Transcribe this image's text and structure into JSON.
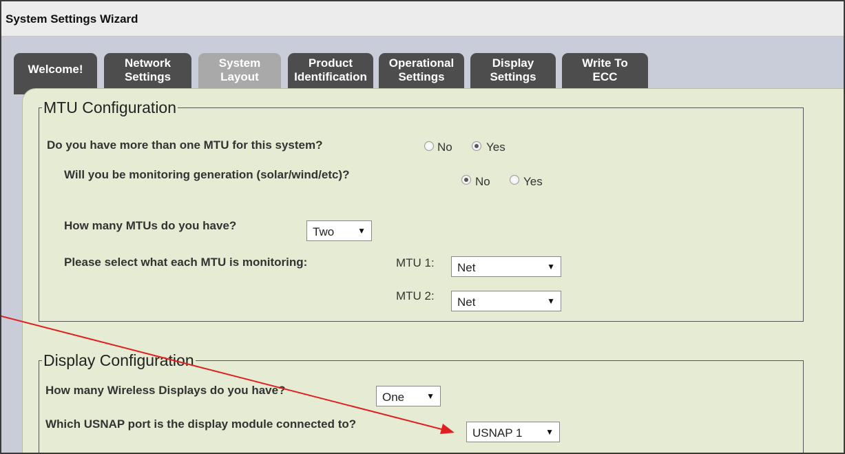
{
  "window": {
    "title": "System Settings Wizard"
  },
  "tabs": [
    {
      "label": "Welcome!",
      "state": "active"
    },
    {
      "label": "Network\nSettings",
      "state": "inactive"
    },
    {
      "label": "System\nLayout",
      "state": "current"
    },
    {
      "label": "Product\nIdentification",
      "state": "inactive"
    },
    {
      "label": "Operational\nSettings",
      "state": "inactive"
    },
    {
      "label": "Display\nSettings",
      "state": "inactive"
    },
    {
      "label": "Write To\nECC",
      "state": "inactive"
    }
  ],
  "mtu_config": {
    "legend": "MTU Configuration",
    "q_multiple": "Do you have more than one MTU for this system?",
    "multiple_options": [
      {
        "label": "No",
        "checked": false
      },
      {
        "label": "Yes",
        "checked": true
      }
    ],
    "q_generation": "Will you be monitoring generation (solar/wind/etc)?",
    "generation_options": [
      {
        "label": "No",
        "checked": true
      },
      {
        "label": "Yes",
        "checked": false
      }
    ],
    "q_count": "How many MTUs do you have?",
    "count_value": "Two",
    "q_monitoring": "Please select what each MTU is monitoring:",
    "mtu1_label": "MTU 1:",
    "mtu1_value": "Net",
    "mtu2_label": "MTU 2:",
    "mtu2_value": "Net"
  },
  "display_config": {
    "legend": "Display Configuration",
    "q_count": "How many Wireless Displays do you have?",
    "count_value": "One",
    "q_port": "Which USNAP port is the display module connected to?",
    "port_value": "USNAP 1"
  },
  "colors": {
    "panel_bg": "#e6ebd3",
    "tab_dark": "#4d4d4d",
    "tab_light": "#a9a9a9",
    "annotation_arrow": "#e02020"
  },
  "icons": {
    "dropdown": "triangle-down",
    "annotation": "red-arrow"
  }
}
